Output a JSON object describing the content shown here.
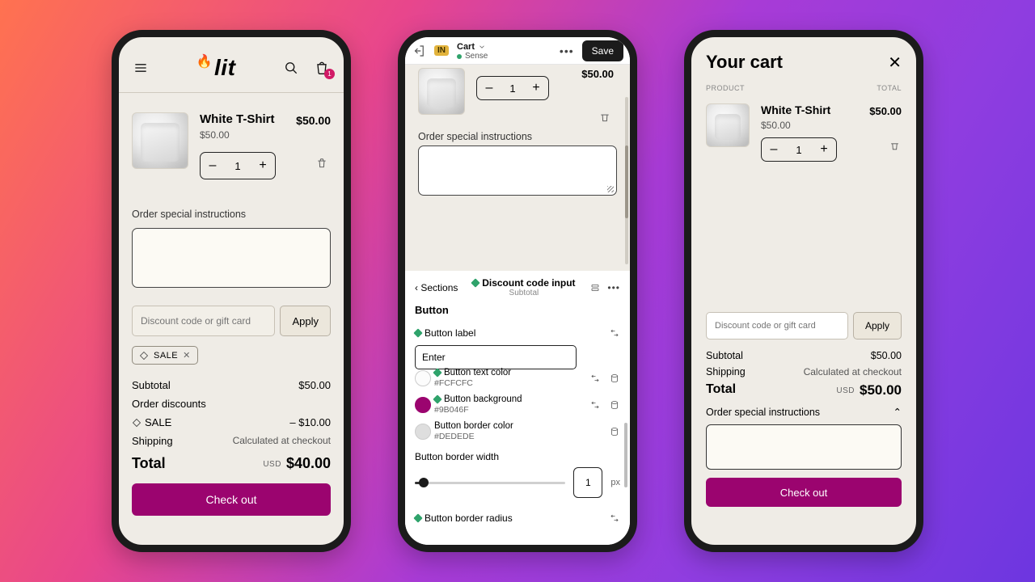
{
  "phone1": {
    "logo": "lit",
    "cart_count": "1",
    "item": {
      "name": "White T-Shirt",
      "unit_price": "$50.00",
      "line_price": "$50.00",
      "qty": "1"
    },
    "osi_label": "Order special instructions",
    "discount_placeholder": "Discount code or gift card",
    "apply": "Apply",
    "chip": "SALE",
    "rows": {
      "subtotal_l": "Subtotal",
      "subtotal_v": "$50.00",
      "disc_l": "Order discounts",
      "sale_l": "SALE",
      "sale_v": "– $10.00",
      "ship_l": "Shipping",
      "ship_v": "Calculated at checkout",
      "total_l": "Total",
      "currency": "USD",
      "total_v": "$40.00"
    },
    "checkout": "Check out"
  },
  "phone2": {
    "topbadge": "IN",
    "nav_title": "Cart",
    "nav_sub": "Sense",
    "save": "Save",
    "preview": {
      "price": "$50.00",
      "qty": "1",
      "osi": "Order special instructions"
    },
    "panel": {
      "back": "Sections",
      "title": "Discount code input",
      "sub": "Subtotal",
      "group": "Button",
      "label_row": "Button label",
      "input_value": "Enter",
      "text_color_l": "Button text color",
      "text_color_v": "#FCFCFC",
      "bg_l": "Button background",
      "bg_v": "#9B046F",
      "border_l": "Button border color",
      "border_v": "#DEDEDE",
      "bw_l": "Button border width",
      "bw_v": "1",
      "bw_unit": "px",
      "br_l": "Button border radius"
    }
  },
  "phone3": {
    "title": "Your cart",
    "col_product": "PRODUCT",
    "col_total": "TOTAL",
    "item": {
      "name": "White T-Shirt",
      "unit_price": "$50.00",
      "line_price": "$50.00",
      "qty": "1"
    },
    "discount_placeholder": "Discount code or gift card",
    "apply": "Apply",
    "rows": {
      "subtotal_l": "Subtotal",
      "subtotal_v": "$50.00",
      "ship_l": "Shipping",
      "ship_v": "Calculated at checkout",
      "total_l": "Total",
      "currency": "USD",
      "total_v": "$50.00"
    },
    "osi_label": "Order special instructions",
    "checkout": "Check out"
  },
  "colors": {
    "primary": "#9B046F"
  }
}
